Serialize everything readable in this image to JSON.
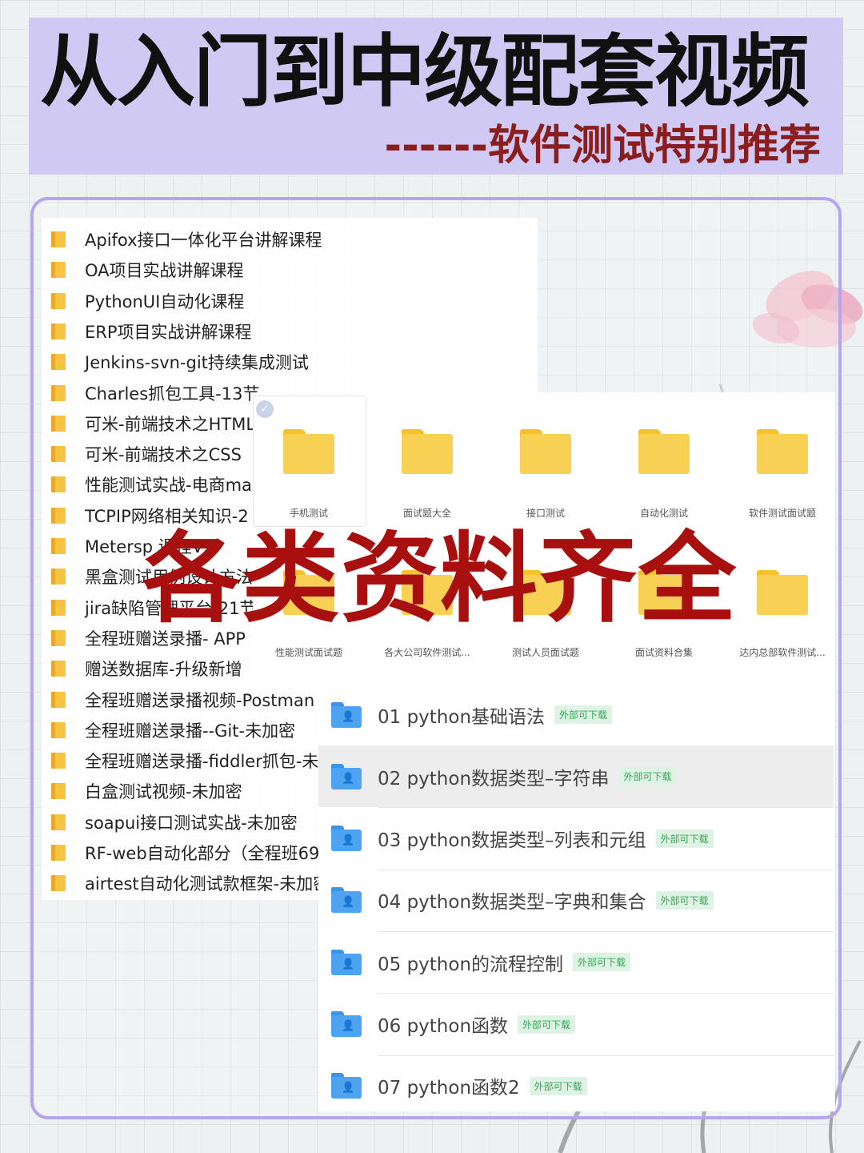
{
  "banner": {
    "title": "从入门到中级配套视频",
    "subtitle": "------软件测试特别推荐"
  },
  "left_list": {
    "items": [
      "Apifox接口一体化平台讲解课程",
      "OA项目实战讲解课程",
      "PythonUI自动化课程",
      "ERP项目实战讲解课程",
      "Jenkins-svn-git持续集成测试",
      "Charles抓包工具-13节",
      "可米-前端技术之HTML",
      "可米-前端技术之CSS",
      "性能测试实战-电商ma",
      "TCPIP网络相关知识-2",
      "Metersp    课程V2",
      "黑盒测试用例设计方法",
      "jira缺陷管理平台-21节",
      "全程班赠送录播- APP",
      "赠送数据库-升级新增",
      "全程班赠送录播视频-Postman",
      "全程班赠送录播--Git-未加密",
      "全程班赠送录播-fiddler抓包-未",
      "白盒测试视频-未加密",
      "soapui接口测试实战-未加密",
      "RF-web自动化部分（全程班69",
      "airtest自动化测试款框架-未加密"
    ]
  },
  "grid": {
    "row1": [
      "手机测试",
      "面试题大全",
      "接口测试",
      "自动化测试",
      "软件测试面试题"
    ],
    "row2": [
      "性能测试面试题",
      "各大公司软件测试...",
      "测试人员面试题",
      "面试资料合集",
      "达内总部软件测试..."
    ]
  },
  "watermark": "各类资料齐全",
  "lessons": {
    "badge": "外部可下载",
    "items": [
      "01 python基础语法",
      "02 python数据类型–字符串",
      "03 python数据类型–列表和元组",
      "04 python数据类型–字典和集合",
      "05 python的流程控制",
      "06 python函数",
      "07 python函数2"
    ],
    "selected_index": 1
  },
  "colors": {
    "banner_bg": "#cfc9f3",
    "frame_border": "#b3a6ee",
    "watermark": "#a80f0f",
    "subtitle": "#8a1d1d",
    "folder_yellow": "#f8d053",
    "folder_blue": "#4da3f0",
    "badge_green": "#2faa55"
  }
}
